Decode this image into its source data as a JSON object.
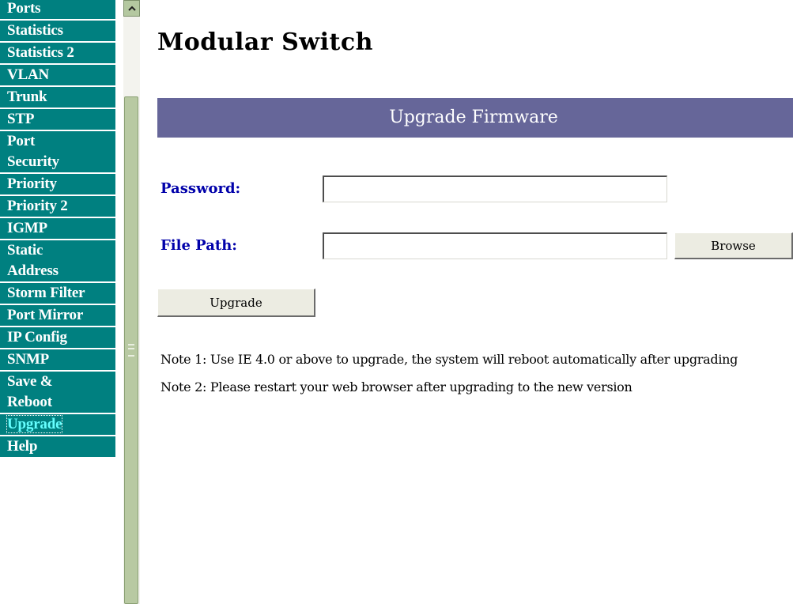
{
  "nav": {
    "items": [
      {
        "label": "Ports"
      },
      {
        "label": "Statistics"
      },
      {
        "label": "Statistics 2"
      },
      {
        "label": "VLAN"
      },
      {
        "label": "Trunk"
      },
      {
        "label": "STP"
      },
      {
        "label": "Port Security"
      },
      {
        "label": "Priority"
      },
      {
        "label": "Priority 2"
      },
      {
        "label": "IGMP"
      },
      {
        "label": "Static Address"
      },
      {
        "label": "Storm Filter"
      },
      {
        "label": "Port Mirror"
      },
      {
        "label": "IP Config"
      },
      {
        "label": "SNMP"
      },
      {
        "label": "Save & Reboot"
      },
      {
        "label": "Upgrade"
      },
      {
        "label": "Help"
      }
    ],
    "wrapped": {
      "port_security": [
        "Port",
        "Security"
      ],
      "static_address": [
        "Static",
        "Address"
      ],
      "save_reboot": [
        "Save &",
        "Reboot"
      ]
    },
    "active": "Upgrade",
    "bg_color": "#008080"
  },
  "page": {
    "title": "Modular Switch",
    "banner": "Upgrade Firmware",
    "banner_color": "#666699"
  },
  "form": {
    "password_label": "Password:",
    "password_value": "",
    "filepath_label": "File Path:",
    "filepath_value": "",
    "browse_label": "Browse",
    "upgrade_label": "Upgrade",
    "label_color": "#0000aa"
  },
  "notes": {
    "note1": "Note 1: Use IE 4.0 or above to upgrade, the system will reboot automatically after upgrading",
    "note2": "Note 2: Please restart your web browser after upgrading to the new version"
  },
  "scrollbar": {
    "up_icon": "arrow-up-icon",
    "grip_icon": "scroll-grip-icon"
  }
}
